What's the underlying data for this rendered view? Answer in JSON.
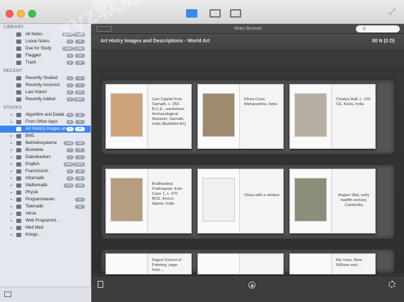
{
  "sidebar": {
    "library_title": "LIBRARY",
    "library": [
      {
        "label": "All Notes",
        "b1": "1468",
        "b2": "6974"
      },
      {
        "label": "Loose Notes",
        "b1": "0",
        "b2": "76"
      },
      {
        "label": "Due for Study",
        "b1": "1468",
        "b2": "1496"
      },
      {
        "label": "Flagged",
        "b1": "0",
        "b2": "18"
      },
      {
        "label": "Trash",
        "b1": "0",
        "b2": "18"
      }
    ],
    "recent_title": "RECENT",
    "recent": [
      {
        "label": "Recently Studied",
        "b1": "4",
        "b2": "4"
      },
      {
        "label": "Recently Incorrect",
        "b1": "0",
        "b2": "0"
      },
      {
        "label": "Last Import",
        "b1": "0",
        "b2": "870"
      },
      {
        "label": "Recently Added",
        "b1": "0",
        "b2": "3837"
      }
    ],
    "stacks_title": "STACKS",
    "stacks": [
      {
        "label": "Algorithm and Datatr…",
        "b1": "0",
        "b2": "45"
      },
      {
        "label": "From Other Apps",
        "b1": "0",
        "b2": "0"
      },
      {
        "label": "Art History Images an",
        "b1": "0",
        "b2": "50"
      },
      {
        "label": "BWL",
        "b1": "",
        "b2": ""
      },
      {
        "label": "Betriebssysteme",
        "b1": "149",
        "b2": "160"
      },
      {
        "label": "Biometrie",
        "b1": "7",
        "b2": "73"
      },
      {
        "label": "Datenbanken",
        "b1": "0",
        "b2": "5"
      },
      {
        "label": "English",
        "b1": "848",
        "b2": "1400"
      },
      {
        "label": "Französisch",
        "b1": "0",
        "b2": "45"
      },
      {
        "label": "Informatik",
        "b1": "0",
        "b2": "10"
      },
      {
        "label": "Mathematik",
        "b1": "149",
        "b2": "160"
      },
      {
        "label": "Physik",
        "b1": "",
        "b2": ""
      },
      {
        "label": "Programmieren",
        "b1": "",
        "b2": "11"
      },
      {
        "label": "Telematik",
        "b1": "",
        "b2": "11"
      },
      {
        "label": "Verse",
        "b1": "",
        "b2": ""
      },
      {
        "label": "Web Programmi…",
        "b1": "",
        "b2": ""
      },
      {
        "label": "Med Med",
        "b1": "",
        "b2": ""
      },
      {
        "label": "Kriegs…",
        "b1": "",
        "b2": ""
      }
    ]
  },
  "toolbar": {
    "title": "Notes Browser",
    "search_placeholder": "Q"
  },
  "deck": {
    "title": "Art Histry Images and Descriptions - World Art",
    "duration": "50 N (0 D)"
  },
  "cards": [
    [
      "Lion Capital from Sarnath, c. 250 B.C.E., sandstone, Archaeological Museum, Sarnath, India (Buddhist Art)",
      "Eilora Cave, Maharashtra, India",
      "Chaitya Hall, c. 100 CE, Karla, India"
    ],
    [
      "Bodhisattva Padmapani, from Cave 1, c. 475 BCE, fresco, Ajanta, India",
      "Shiva with a nimbus",
      "Angkor Wat, early twelfth century, Cambodia"
    ],
    [
      "Rajput School of Painting, page from…",
      "",
      "Ma Yuan, Bare Willows and…"
    ]
  ],
  "watermark": "xyz軟體補給站 http://31.to"
}
